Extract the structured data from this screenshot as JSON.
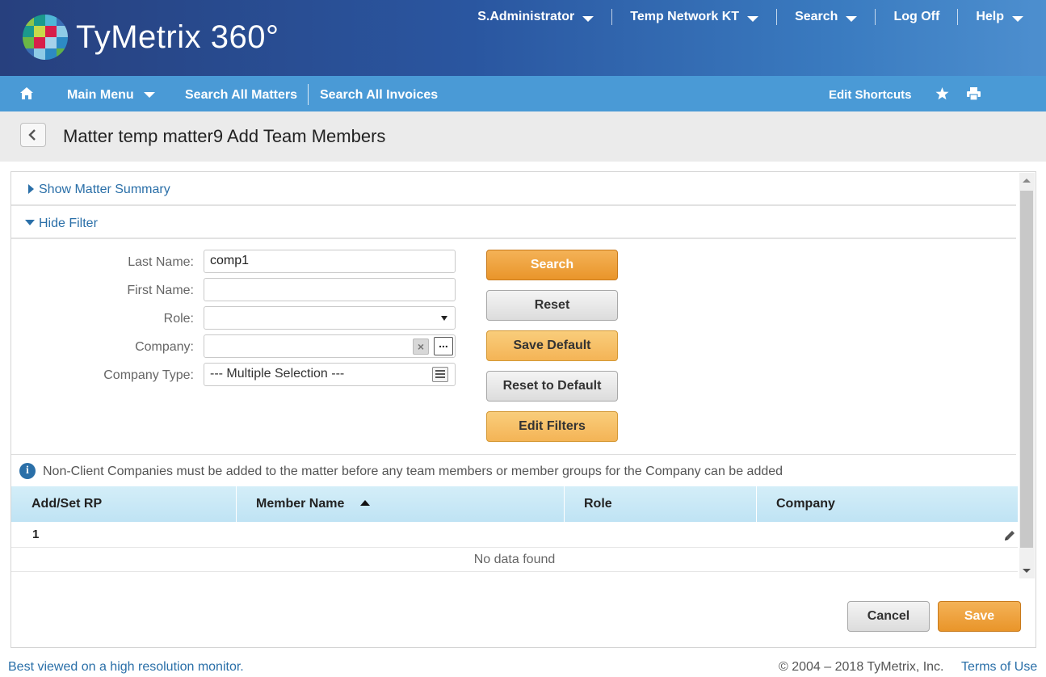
{
  "header": {
    "brand": "TyMetrix 360°",
    "user_menu": "S.Administrator",
    "network_menu": "Temp Network KT",
    "search_menu": "Search",
    "logoff": "Log Off",
    "help_menu": "Help"
  },
  "navbar": {
    "home_icon": "home-icon",
    "main_menu": "Main Menu",
    "search_matters": "Search All Matters",
    "search_invoices": "Search All Invoices",
    "edit_shortcuts": "Edit Shortcuts",
    "star_icon": "star-icon",
    "print_icon": "print-icon"
  },
  "page": {
    "title": "Matter temp matter9 Add Team Members"
  },
  "sections": {
    "show_summary": "Show Matter Summary",
    "hide_filter": "Hide Filter"
  },
  "filter": {
    "last_name_label": "Last Name:",
    "last_name_value": "comp1",
    "first_name_label": "First Name:",
    "first_name_value": "",
    "role_label": "Role:",
    "role_value": "",
    "company_label": "Company:",
    "company_value": "",
    "company_type_label": "Company Type:",
    "company_type_value": "--- Multiple Selection ---"
  },
  "buttons": {
    "search": "Search",
    "reset": "Reset",
    "save_default": "Save Default",
    "reset_default": "Reset to Default",
    "edit_filters": "Edit Filters",
    "cancel": "Cancel",
    "save": "Save"
  },
  "info": {
    "message": "Non-Client Companies must be added to the matter before any team members or member groups for the Company can be added"
  },
  "table": {
    "columns": [
      "Add/Set RP",
      "Member Name",
      "Role",
      "Company"
    ],
    "page_number": "1",
    "empty_message": "No data found"
  },
  "footer": {
    "note": "Best viewed on a high resolution monitor.",
    "copyright": "© 2004 – 2018 TyMetrix, Inc.",
    "terms": "Terms of Use"
  },
  "colors": {
    "header_dark": "#27407e",
    "navbar": "#4a9ad6",
    "link": "#2a6fa8",
    "primary_button": "#e9952a"
  }
}
